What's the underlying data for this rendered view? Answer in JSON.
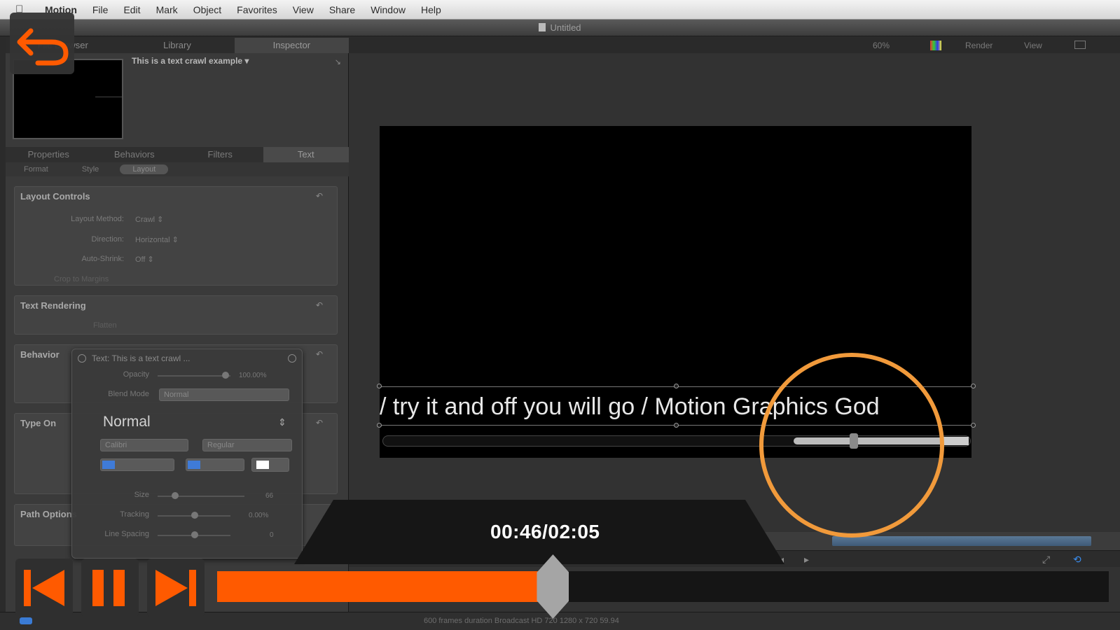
{
  "menubar": {
    "items": [
      "Motion",
      "File",
      "Edit",
      "Mark",
      "Object",
      "Favorites",
      "View",
      "Share",
      "Window",
      "Help"
    ]
  },
  "window": {
    "title": "Untitled"
  },
  "left_panel": {
    "tabs": [
      "File Browser",
      "Library",
      "Inspector"
    ],
    "active_tab": "Inspector",
    "layer_name": "This is a text crawl example",
    "inspector_tabs": [
      "Properties",
      "Behaviors",
      "Filters",
      "Text"
    ],
    "active_inspector_tab": "Text",
    "text_subtabs": [
      "Format",
      "Style",
      "Layout"
    ],
    "active_subtab": "Layout",
    "layout_controls": {
      "header": "Layout Controls",
      "layout_method_label": "Layout Method:",
      "layout_method_value": "Crawl",
      "direction_label": "Direction:",
      "direction_value": "Horizontal",
      "auto_shrink_label": "Auto-Shrink:",
      "auto_shrink_value": "Off",
      "crop_label": "Crop to Margins"
    },
    "text_rendering": {
      "header": "Text Rendering",
      "flatten_label": "Flatten"
    },
    "behaviors_header": "Behavior",
    "type_on_header": "Type On",
    "path_options_header": "Path Options"
  },
  "hud": {
    "title": "Text: This is a text crawl ...",
    "opacity_label": "Opacity",
    "opacity_value": "100.00%",
    "blend_mode_label": "Blend Mode",
    "blend_mode_value": "Normal",
    "font_style": "Normal",
    "font_family": "Calibri",
    "font_weight": "Regular",
    "size_label": "Size",
    "size_value": "66",
    "tracking_label": "Tracking",
    "tracking_value": "0.00%",
    "line_spacing_label": "Line Spacing",
    "line_spacing_value": "0",
    "text_color": "#ffffff"
  },
  "canvas_toolbar": {
    "zoom": "60%",
    "render_label": "Render",
    "view_label": "View"
  },
  "canvas": {
    "crawl_text": "/ try it and off you will go / Motion Graphics God"
  },
  "player": {
    "timecode": "00:46/02:05",
    "progress_fraction": 0.368,
    "accent_color": "#ff5a00",
    "highlight_color": "#f19a3b"
  },
  "statusbar": {
    "text": "600 frames duration Broadcast HD 720 1280 x 720 59.94"
  },
  "icons": [
    "apple-icon",
    "back-arrow-icon",
    "skip-back-icon",
    "pause-icon",
    "skip-forward-icon",
    "play-icon",
    "record-icon"
  ]
}
